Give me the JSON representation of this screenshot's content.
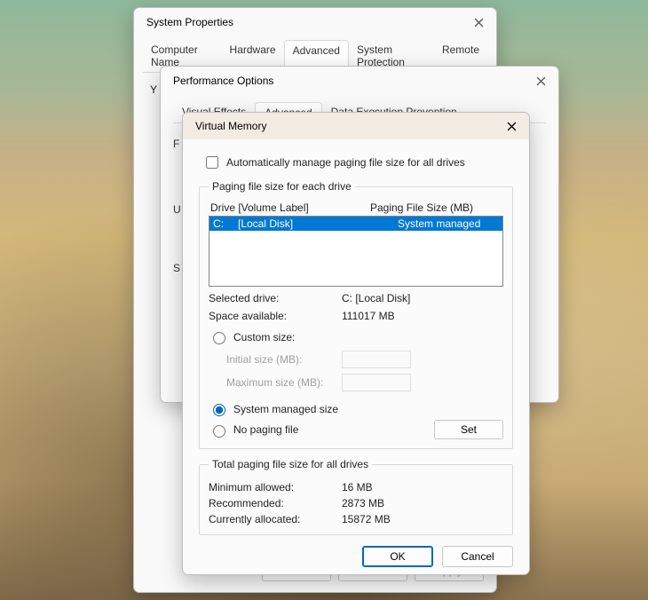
{
  "sysprops": {
    "title": "System Properties",
    "tabs": [
      "Computer Name",
      "Hardware",
      "Advanced",
      "System Protection",
      "Remote"
    ],
    "active_tab": 2,
    "body_hint": "Y",
    "buttons": {
      "ok": "OK",
      "cancel": "Cancel",
      "apply": "Apply"
    }
  },
  "perfopts": {
    "title": "Performance Options",
    "tabs": [
      "Visual Effects",
      "Advanced",
      "Data Execution Prevention"
    ],
    "active_tab": 1,
    "trunc_P": "F",
    "trunc_U": "U",
    "trunc_S": "S"
  },
  "vmem": {
    "title": "Virtual Memory",
    "auto_manage_checked": false,
    "auto_manage_label": "Automatically manage paging file size for all drives",
    "group1_legend": "Paging file size for each drive",
    "header_drive": "Drive  [Volume Label]",
    "header_size": "Paging File Size (MB)",
    "drives": [
      {
        "letter": "C:",
        "label": "[Local Disk]",
        "size": "System managed"
      }
    ],
    "selected_drive_k": "Selected drive:",
    "selected_drive_v": "C:  [Local Disk]",
    "space_avail_k": "Space available:",
    "space_avail_v": "111017 MB",
    "radio_custom": "Custom size:",
    "initial_lbl": "Initial size (MB):",
    "max_lbl": "Maximum size (MB):",
    "radio_system": "System managed size",
    "radio_none": "No paging file",
    "set_btn": "Set",
    "group2_legend": "Total paging file size for all drives",
    "min_k": "Minimum allowed:",
    "min_v": "16 MB",
    "rec_k": "Recommended:",
    "rec_v": "2873 MB",
    "cur_k": "Currently allocated:",
    "cur_v": "15872 MB",
    "ok": "OK",
    "cancel": "Cancel"
  }
}
